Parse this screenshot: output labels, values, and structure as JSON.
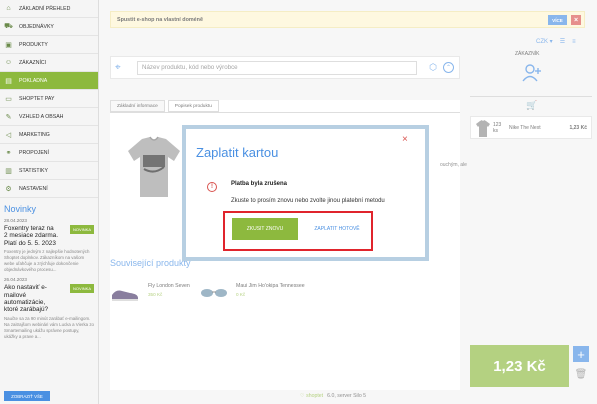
{
  "sidebar": {
    "items": [
      {
        "label": "ZÁKLADNÍ PŘEHLED",
        "icon": "home-icon",
        "active": false
      },
      {
        "label": "OBJEDNÁVKY",
        "icon": "cart-icon",
        "active": false
      },
      {
        "label": "PRODUKTY",
        "icon": "box-icon",
        "active": false
      },
      {
        "label": "ZÁKAZNÍCI",
        "icon": "users-icon",
        "active": false
      },
      {
        "label": "POKLADNA",
        "icon": "register-icon",
        "active": true
      },
      {
        "label": "SHOPTET PAY",
        "icon": "card-icon",
        "active": false
      },
      {
        "label": "VZHLED A OBSAH",
        "icon": "brush-icon",
        "active": false
      },
      {
        "label": "MARKETING",
        "icon": "megaphone-icon",
        "active": false
      },
      {
        "label": "PROPOJENÍ",
        "icon": "link-icon",
        "active": false
      },
      {
        "label": "STATISTIKY",
        "icon": "chart-icon",
        "active": false
      },
      {
        "label": "NASTAVENÍ",
        "icon": "gear-icon",
        "active": false
      }
    ],
    "news_title": "Novinky",
    "news": [
      {
        "date": "28.04.2023",
        "headline": "Foxentry teraz na 2 mesiace zdarma. Platí do 5. 5. 2023",
        "badge": "NOVINKA",
        "text": "Foxentry je jedným z najlepšie hodnotených Shoptet doplnkov. Zákazníkom na vašom webe uľahčuje a zrýchľuje dokončenie objednávkového procesu..."
      },
      {
        "date": "26.04.2023",
        "headline": "Ako nastaviť e-mailové automatizácie, ktoré zarábajú?",
        "badge": "NOVINKA",
        "text": "Naučte sa za 90 minút zarábať e-mailingom. Na zaitrajšom webinári vám Lucka a Vierka zo Smartemailing ukážu správne postupy, ukážky a prave a..."
      }
    ],
    "show_all": "ZOBRAZIŤ VŠE"
  },
  "banner": {
    "text": "Spustit e-shop na vlastní doméně",
    "more": "VÍCE",
    "close": "×"
  },
  "search": {
    "placeholder": "Název produktu, kód nebo výrobce"
  },
  "tabs": [
    {
      "label": "Základní informace",
      "active": true
    },
    {
      "label": "Popisek produktu",
      "active": false
    }
  ],
  "desc_snippet": "ouchým, ale",
  "related": {
    "title": "Související produkty",
    "items": [
      {
        "name": "Fly London Seven",
        "price": "350 Kč"
      },
      {
        "name": "Maui Jim Ho'okipa Tennessee",
        "price": "0 Kč"
      }
    ]
  },
  "topright": {
    "currency": "CZK"
  },
  "customer_label": "ZÁKAZNÍK",
  "cart": {
    "qty": "123 ks",
    "product": "Nike The Next",
    "price": "1,23 Kč"
  },
  "total": "1,23 Kč",
  "footer": {
    "brand": "shoptet",
    "version": "6.0, server Silo 5"
  },
  "modal": {
    "title": "Zaplatit kartou",
    "close": "×",
    "error_title": "Platba byla zrušena",
    "error_text": "Zkuste to prosím znovu nebo zvolte jinou platební metodu",
    "retry": "ZKUSIT ZNOVU",
    "cash": "ZAPLATIT HOTOVĚ"
  },
  "colors": {
    "accent_green": "#8db93e",
    "accent_blue": "#4a90e2",
    "danger": "#d9534f",
    "highlight_red": "#e0242c"
  }
}
